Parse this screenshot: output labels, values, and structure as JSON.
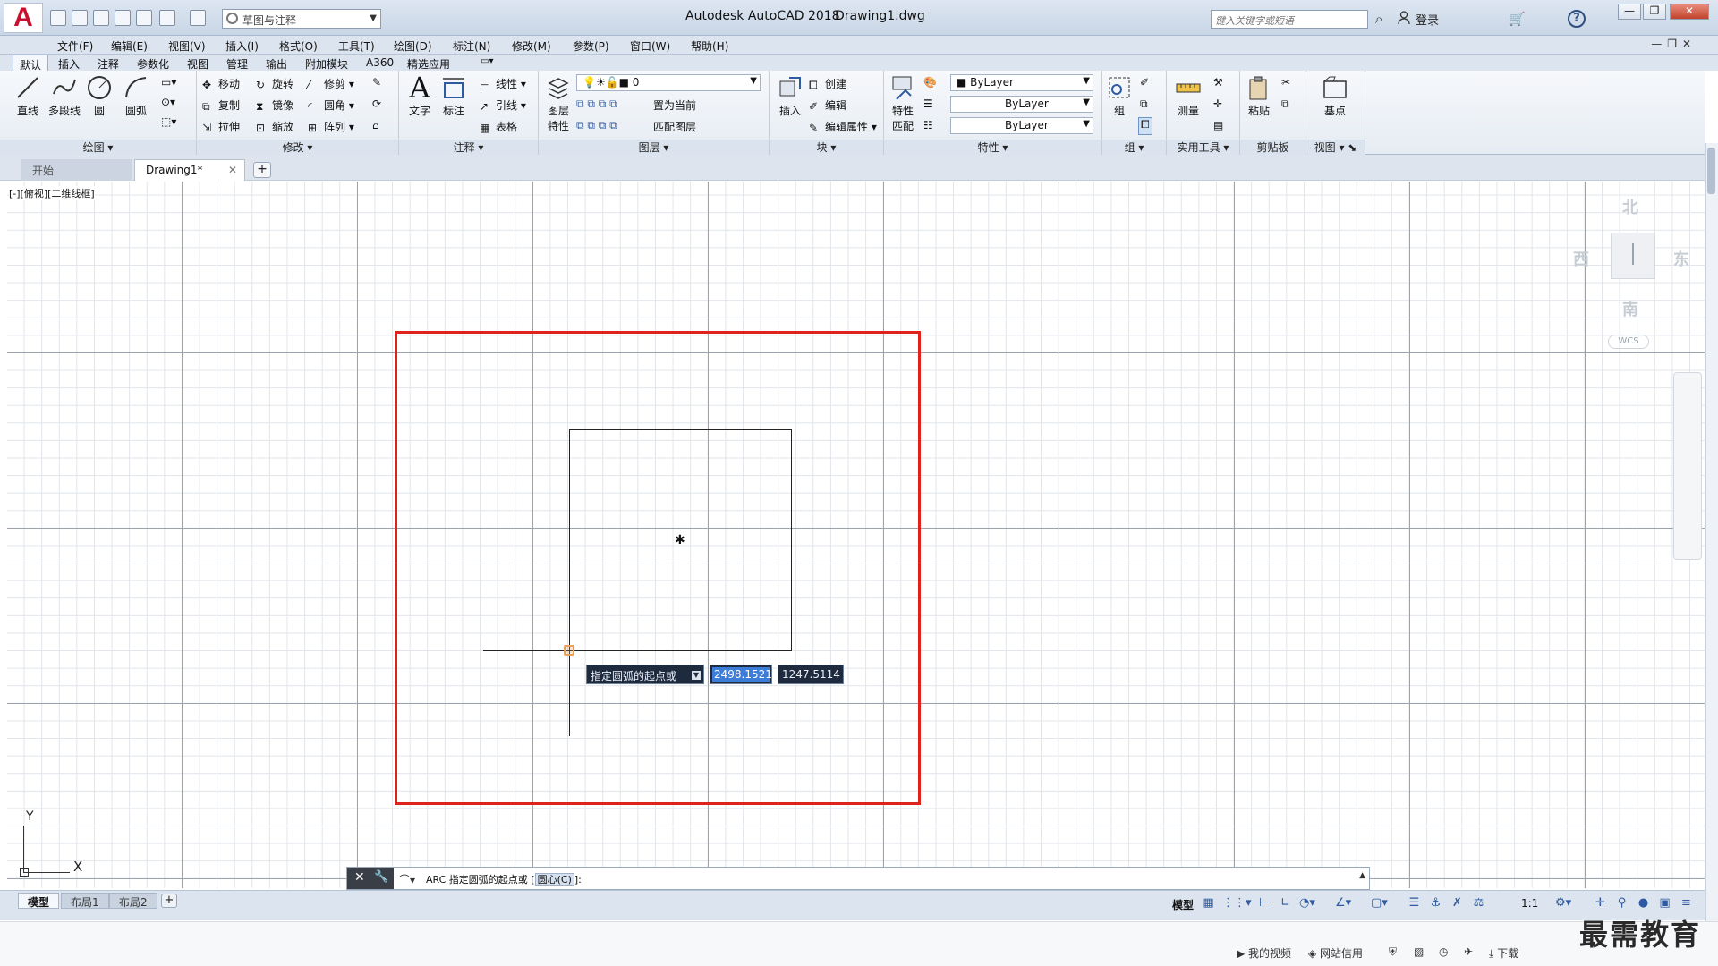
{
  "titlebar": {
    "app_title": "Autodesk AutoCAD 2018",
    "file_title": "Drawing1.dwg",
    "workspace": "草图与注释",
    "search_placeholder": "键入关键字或短语",
    "login": "登录"
  },
  "menu": [
    "文件(F)",
    "编辑(E)",
    "视图(V)",
    "插入(I)",
    "格式(O)",
    "工具(T)",
    "绘图(D)",
    "标注(N)",
    "修改(M)",
    "参数(P)",
    "窗口(W)",
    "帮助(H)"
  ],
  "ribbon_tabs": [
    "默认",
    "插入",
    "注释",
    "参数化",
    "视图",
    "管理",
    "输出",
    "附加模块",
    "A360",
    "精选应用"
  ],
  "ribbon": {
    "draw": {
      "title": "绘图",
      "line": "直线",
      "polyline": "多段线",
      "circle": "圆",
      "arc": "圆弧"
    },
    "modify": {
      "title": "修改",
      "move": "移动",
      "rotate": "旋转",
      "trim": "修剪",
      "copy": "复制",
      "mirror": "镜像",
      "fillet": "圆角",
      "stretch": "拉伸",
      "scale": "缩放",
      "array": "阵列"
    },
    "annotation": {
      "title": "注释",
      "text": "文字",
      "dimension": "标注",
      "linear": "线性",
      "leader": "引线",
      "table": "表格"
    },
    "layers": {
      "title": "图层",
      "layer_props_1": "图层",
      "layer_props_2": "特性",
      "current_layer": "0",
      "set_current": "置为当前",
      "match_layer": "匹配图层"
    },
    "block": {
      "title": "块",
      "insert": "插入",
      "create": "创建",
      "edit": "编辑",
      "edit_attr": "编辑属性"
    },
    "properties": {
      "title": "特性",
      "match_1": "特性",
      "match_2": "匹配",
      "color": "ByLayer",
      "linetype": "ByLayer",
      "lineweight": "ByLayer"
    },
    "groups": {
      "title": "组",
      "group": "组"
    },
    "utilities": {
      "title": "实用工具",
      "measure": "测量"
    },
    "clipboard": {
      "title": "剪贴板",
      "paste": "粘贴"
    },
    "view": {
      "title": "视图",
      "base": "基点"
    }
  },
  "file_tabs": {
    "start": "开始",
    "drawing": "Drawing1*"
  },
  "viewport_label": "[-][俯视][二维线框]",
  "viewcube": {
    "north": "北",
    "south": "南",
    "east": "东",
    "west": "西",
    "wcs": "WCS"
  },
  "dynamic_input": {
    "prompt": "指定圆弧的起点或",
    "x": "2498.1521",
    "y": "1247.5114"
  },
  "ucs": {
    "x": "X",
    "y": "Y"
  },
  "command_line": {
    "prefix": "ARC 指定圆弧的起点或 [",
    "option": "圆心(C)",
    "suffix": "]:"
  },
  "layout_tabs": [
    "模型",
    "布局1",
    "布局2"
  ],
  "status": {
    "model": "模型",
    "scale": "1:1"
  },
  "taskbar": {
    "video": "我的视频",
    "web": "网站信用",
    "download": "下载"
  },
  "watermark": "最需教育",
  "colors": {
    "frame": "#e0221c",
    "accent": "#3b7dd8",
    "snap": "#e7a15a"
  }
}
